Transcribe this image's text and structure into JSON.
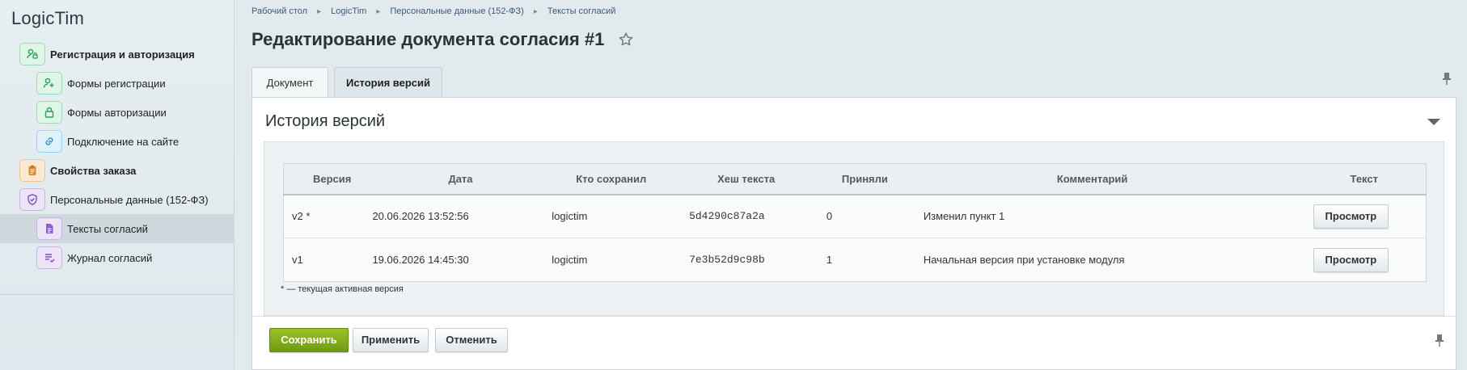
{
  "app": {
    "brand": "LogicTim"
  },
  "sidebar": {
    "items": [
      {
        "label": "Регистрация и авторизация",
        "icon": "user-key-icon"
      },
      {
        "label": "Формы регистрации",
        "icon": "user-plus-icon"
      },
      {
        "label": "Формы авторизации",
        "icon": "lock-icon"
      },
      {
        "label": "Подключение на сайте",
        "icon": "link-icon"
      },
      {
        "label": "Свойства заказа",
        "icon": "clipboard-icon"
      },
      {
        "label": "Персональные данные (152-ФЗ)",
        "icon": "shield-check-icon"
      },
      {
        "label": "Тексты согласий",
        "icon": "document-icon"
      },
      {
        "label": "Журнал согласий",
        "icon": "journal-list-icon"
      }
    ]
  },
  "breadcrumb": [
    "Рабочий стол",
    "LogicTim",
    "Персональные данные (152-ФЗ)",
    "Тексты согласий"
  ],
  "page": {
    "title": "Редактирование документа согласия #1"
  },
  "tabs": [
    {
      "label": "Документ",
      "active": false
    },
    {
      "label": "История версий",
      "active": true
    }
  ],
  "section": {
    "title": "История версий"
  },
  "versions_table": {
    "headers": [
      "Версия",
      "Дата",
      "Кто сохранил",
      "Хеш текста",
      "Приняли",
      "Комментарий",
      "Текст"
    ],
    "rows": [
      {
        "version": "v2 *",
        "date": "20.06.2026 13:52:56",
        "user": "logictim",
        "hash": "5d4290c87a2a",
        "accepted": "0",
        "comment": "Изменил пункт 1",
        "action": "Просмотр"
      },
      {
        "version": "v1",
        "date": "19.06.2026 14:45:30",
        "user": "logictim",
        "hash": "7e3b52d9c98b",
        "accepted": "1",
        "comment": "Начальная версия при установке модуля",
        "action": "Просмотр"
      }
    ],
    "note": "* — текущая активная версия"
  },
  "footer": {
    "save": "Сохранить",
    "apply": "Применить",
    "cancel": "Отменить"
  },
  "colors": {
    "accent_green": "#7fa81c",
    "link": "#3e5a78",
    "sidebar_active": "#cfd8dd"
  }
}
